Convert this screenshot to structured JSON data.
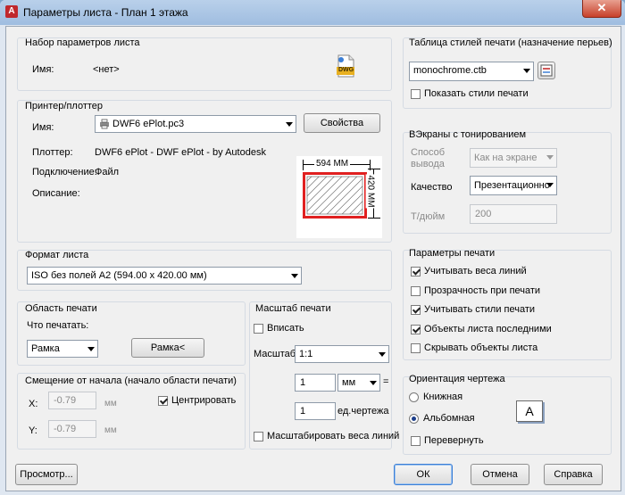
{
  "window": {
    "title": "Параметры листа - План 1 этажа",
    "close_glyph": "✕",
    "app_icon_letter": "A"
  },
  "page_setup": {
    "group_title": "Набор параметров листа",
    "name_label": "Имя:",
    "name_value": "<нет>",
    "dwg_icon_text": "DWG"
  },
  "printer": {
    "group_title": "Принтер/плоттер",
    "name_label": "Имя:",
    "name_value": "DWF6 ePlot.pc3",
    "properties_button": "Свойства",
    "plotter_label": "Плоттер:",
    "plotter_value": "DWF6 ePlot - DWF ePlot - by Autodesk",
    "connection_label": "Подключение:",
    "connection_value": "Файл",
    "description_label": "Описание:",
    "preview_width": "594 ММ",
    "preview_height": "420 ММ"
  },
  "paper_size": {
    "group_title": "Формат листа",
    "value": "ISO без полей A2 (594.00 x 420.00 мм)"
  },
  "plot_area": {
    "group_title": "Область печати",
    "what_label": "Что печатать:",
    "what_value": "Рамка",
    "window_button": "Рамка<"
  },
  "plot_offset": {
    "group_title": "Смещение от начала (начало области печати)",
    "x_label": "X:",
    "x_value": "-0.79",
    "x_unit": "мм",
    "y_label": "Y:",
    "y_value": "-0.79",
    "y_unit": "мм",
    "center_label": "Центрировать",
    "center_checked": true
  },
  "plot_scale": {
    "group_title": "Масштаб печати",
    "fit_label": "Вписать",
    "fit_checked": false,
    "scale_label": "Масштаб:",
    "scale_value": "1:1",
    "value1": "1",
    "unit1": "мм",
    "equals": "=",
    "value2": "1",
    "unit2": "ед.чертежа",
    "scale_lineweights_label": "Масштабировать веса линий",
    "scale_lineweights_checked": false
  },
  "plot_style_table": {
    "group_title": "Таблица стилей печати (назначение перьев)",
    "value": "monochrome.ctb",
    "show_styles_label": "Показать стили печати",
    "show_styles_checked": false
  },
  "shaded_viewport": {
    "group_title": "ВЭкраны с тонированием",
    "shade_label_line1": "Способ",
    "shade_label_line2": "вывода",
    "shade_value": "Как на экране",
    "quality_label": "Качество",
    "quality_value": "Презентационно",
    "dpi_label": "Т/дюйм",
    "dpi_value": "200"
  },
  "plot_options": {
    "group_title": "Параметры печати",
    "items": [
      {
        "label": "Учитывать веса линий",
        "checked": true
      },
      {
        "label": "Прозрачность при печати",
        "checked": false
      },
      {
        "label": "Учитывать стили печати",
        "checked": true
      },
      {
        "label": "Объекты листа последними",
        "checked": true
      },
      {
        "label": "Скрывать объекты листа",
        "checked": false
      }
    ]
  },
  "drawing_orientation": {
    "group_title": "Ориентация чертежа",
    "portrait_label": "Книжная",
    "portrait_selected": false,
    "landscape_label": "Альбомная",
    "landscape_selected": true,
    "upside_down_label": "Перевернуть",
    "upside_down_checked": false,
    "orientation_icon_letter": "A"
  },
  "footer": {
    "preview_button": "Просмотр...",
    "ok_button": "ОК",
    "cancel_button": "Отмена",
    "help_button": "Справка"
  },
  "colors": {
    "preview_frame": "#e02020",
    "accent": "#3c7fd6"
  }
}
